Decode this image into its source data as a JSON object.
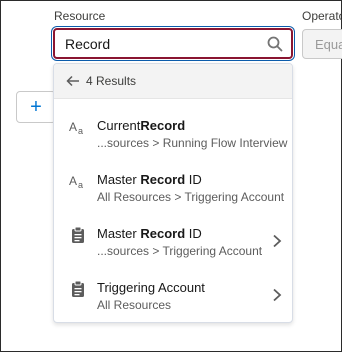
{
  "form": {
    "resource_label": "Resource",
    "operator_label": "Operator",
    "operator_value": "Equals"
  },
  "search": {
    "value": "Record",
    "icon": "search-icon"
  },
  "add_button": {
    "label": "+"
  },
  "dropdown": {
    "results_label": "4 Results",
    "options": [
      {
        "icon": "text-type-icon",
        "title_pre": "Current",
        "title_match": "Record",
        "title_post": "",
        "subtitle": "...sources > Running Flow Interview",
        "has_chevron": false
      },
      {
        "icon": "text-type-icon",
        "title_pre": "Master ",
        "title_match": "Record",
        "title_post": " ID",
        "subtitle": "All Resources > Triggering Account",
        "has_chevron": false
      },
      {
        "icon": "record-clipboard-icon",
        "title_pre": "Master ",
        "title_match": "Record",
        "title_post": " ID",
        "subtitle": "...sources > Triggering Account",
        "has_chevron": true
      },
      {
        "icon": "record-clipboard-icon",
        "title_pre": "Triggering Account",
        "title_match": "",
        "title_post": "",
        "subtitle": "All Resources",
        "has_chevron": true
      }
    ]
  },
  "colors": {
    "input_border": "#8a1531",
    "focus_ring": "#0b5cab",
    "accent": "#0176d3"
  }
}
